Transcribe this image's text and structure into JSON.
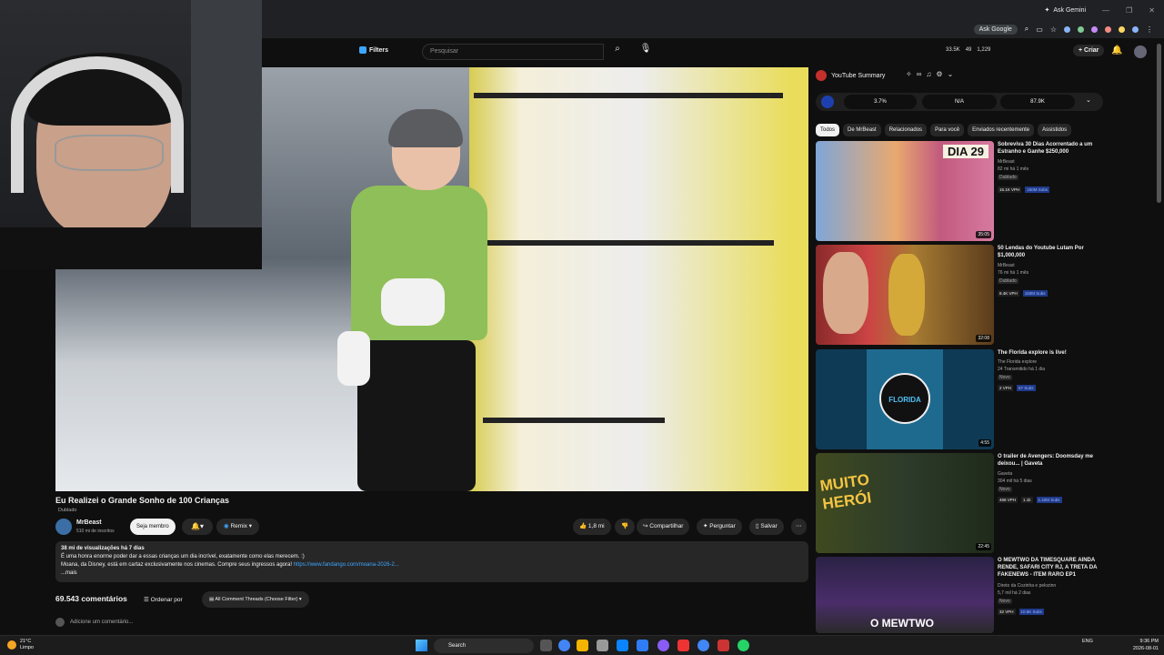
{
  "browser": {
    "ask_gemini": "Ask Gemini",
    "ask_google": "Ask Google"
  },
  "header": {
    "filters_label": "Filters",
    "search_placeholder": "Pesquisar",
    "stats": [
      "33.5K",
      "49",
      "1,229"
    ],
    "create_label": "Criar"
  },
  "video": {
    "title": "Eu Realizei o Grande Sonho de 100 Crianças",
    "dubbed_label": "Dublado",
    "channel_name": "MrBeast",
    "channel_subs": "510 mi de inscritos",
    "member_label": "Seja membro",
    "remix_label": "Remix",
    "likes": "1,8 mi",
    "share_label": "Compartilhar",
    "ask_label": "Perguntar",
    "save_label": "Salvar"
  },
  "description": {
    "meta": "38 mi de visualizações  há 7 dias",
    "line1": "É uma honra enorme poder dar a essas crianças um dia incrível, exatamente como elas merecem. :)",
    "line2_text": "Moana, da Disney, está em cartaz exclusivamente nos cinemas. Compre seus ingressos agora! ",
    "line2_link": "https://www.fandango.com/moana-2026-2...",
    "more": "...mais"
  },
  "comments": {
    "count": "69.543 comentários",
    "sort_label": "Ordenar por",
    "filter_label": "All Comment Threads (Choose Filter)",
    "add_placeholder": "Adicione um comentário..."
  },
  "summary": {
    "title": "YouTube Summary",
    "metrics": [
      "3.7%",
      "N/A",
      "87.9K"
    ]
  },
  "chips": [
    "Todos",
    "De MrBeast",
    "Relacionados",
    "Para você",
    "Enviados recentemente",
    "Assistidos"
  ],
  "recommendations": [
    {
      "title": "Sobreviva 30 Dias Acorrentado a um Estranho e Ganhe $250,000",
      "channel": "MrBeast",
      "meta": "82 mi  há 1 mês",
      "badge": "Dublado",
      "stats": [
        "15.1K VPH",
        "150M Subs"
      ],
      "duration": "35:05",
      "thumb_text": "DIA 29"
    },
    {
      "title": "50 Lendas do Youtube Lutam Por $1,000,000",
      "channel": "MrBeast",
      "meta": "76 mi  há 1 mês",
      "badge": "Dublado",
      "stats": [
        "8.4K VPH",
        "150M Subs"
      ],
      "duration": "32:08",
      "thumb_text": ""
    },
    {
      "title": "The Florida explore  is live!",
      "channel": "The Florida explore",
      "meta": "24  Transmitido há 1 dia",
      "badge": "Novo",
      "stats": [
        "2 VPH",
        "57 Subs"
      ],
      "duration": "4:55",
      "thumb_text": "FLORIDA"
    },
    {
      "title": "O trailer de Avengers: Doomsday me deixou... | Gaveta",
      "channel": "Gaveta",
      "meta": "304 mil  há 5 dias",
      "badge": "Novo",
      "stats": [
        "466 VPH",
        "1.1k",
        "1.42M Subs"
      ],
      "duration": "22:45",
      "thumb_text": "MUITO HERÓI"
    },
    {
      "title": "O MEWTWO DA TIMESQUARE AINDA RENDE, SAFARI CITY RJ, A TRETA DA FAKENEWS - ITEM RARO EP1",
      "channel": "Direto da Cozinha  e pelozinn",
      "meta": "5,7 mil  há 2 dias",
      "badge": "Novo",
      "stats": [
        "32 VPH",
        "10.6K Subs"
      ],
      "duration": "",
      "thumb_text": "O MEWTWO"
    }
  ],
  "taskbar": {
    "weather_temp": "21°C",
    "weather_desc": "Limpo",
    "search_label": "Search",
    "lang": "ENG",
    "time": "9:36 PM",
    "date": "2026-08-01"
  }
}
